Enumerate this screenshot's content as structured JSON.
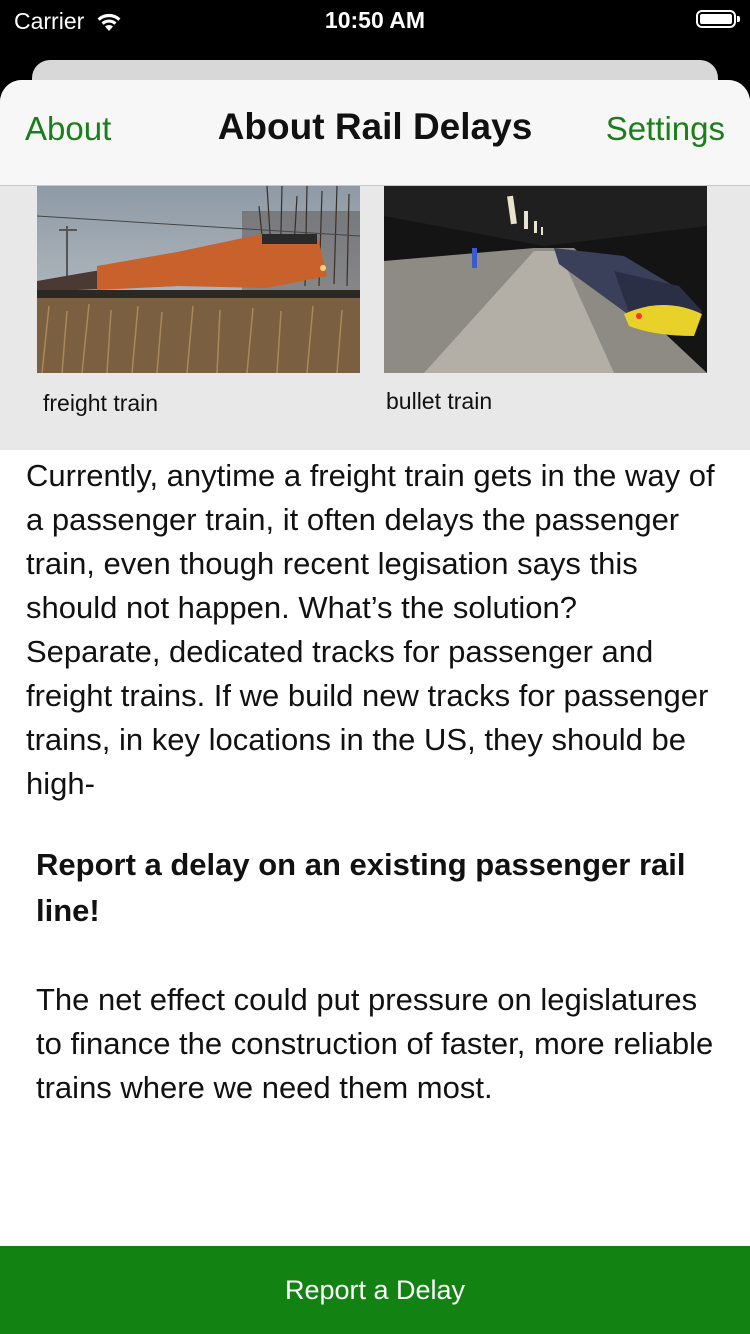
{
  "status_bar": {
    "carrier": "Carrier",
    "time": "10:50 AM",
    "icons": [
      "wifi-icon",
      "battery-icon"
    ]
  },
  "nav": {
    "left_label": "About",
    "title": "About Rail Delays",
    "right_label": "Settings",
    "accent_color": "#1a7f1a"
  },
  "gallery": {
    "items": [
      {
        "caption": "freight train",
        "image": "freight-train-photo"
      },
      {
        "caption": "bullet train",
        "image": "bullet-train-photo"
      }
    ]
  },
  "content": {
    "body": "Currently, anytime a freight train gets in the way of a passenger train, it often delays the passenger train, even though recent legisation says this should not happen. What’s the solution? Separate, dedicated tracks for passenger and freight trains. If we build new tracks for passenger trains, in key locations in the US, they should be high-",
    "report_heading": "Report a delay on an existing passenger rail line!",
    "report_text": "The net effect could put pressure on legislatures to finance the construction of faster, more reliable trains where we need them most."
  },
  "footer": {
    "button_label": "Report a Delay",
    "button_color": "#128212"
  }
}
